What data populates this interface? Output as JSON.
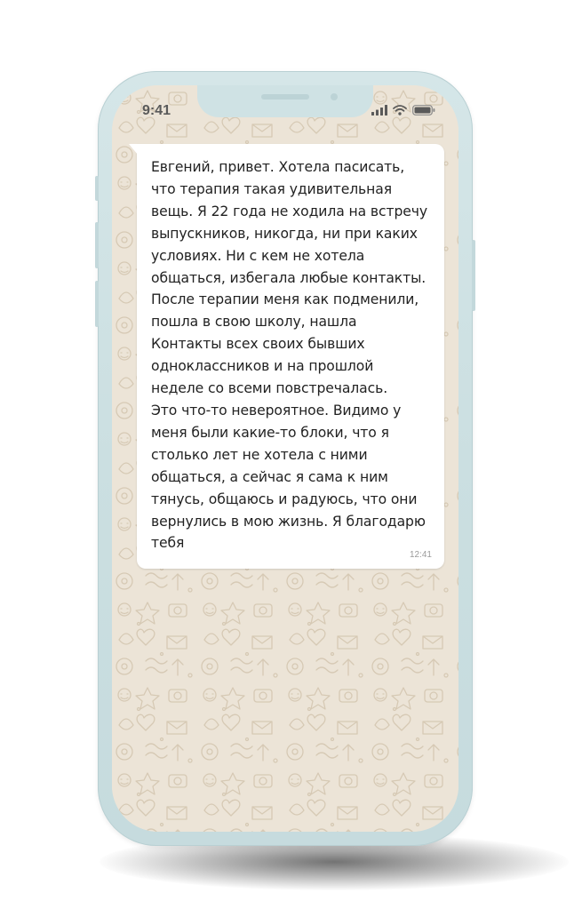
{
  "status_bar": {
    "time": "9:41",
    "icons": [
      "signal-icon",
      "wifi-icon",
      "battery-icon"
    ]
  },
  "message": {
    "text": "Евгений, привет. Хотела пасисать,\nчто терапия такая удивительная\nвещь. Я 22 года не ходила на встречу\nвыпускников, никогда, ни при каких\nусловиях. Ни с кем не хотела\nобщаться, избегала любые контакты.\nПосле терапии меня как подменили,\nпошла в свою школу, нашла\nКонтакты всех своих бывших\nодноклассников и на прошлой\nнеделе со всеми повстречалась.\nЭто что-то невероятное. Видимо у\nменя были какие-то блоки, что я\nстолько лет не хотела с ними\nобщаться, а сейчас я сама к ним\nтянусь, общаюсь и радуюсь, что они\nвернулись в мою жизнь. Я благодарю\nтебя",
    "time": "12:41"
  },
  "colors": {
    "wallpaper": "#ece4d7",
    "doodle": "#d8ccb8",
    "phone_frame": "#cfe2e4",
    "bubble": "#ffffff"
  }
}
